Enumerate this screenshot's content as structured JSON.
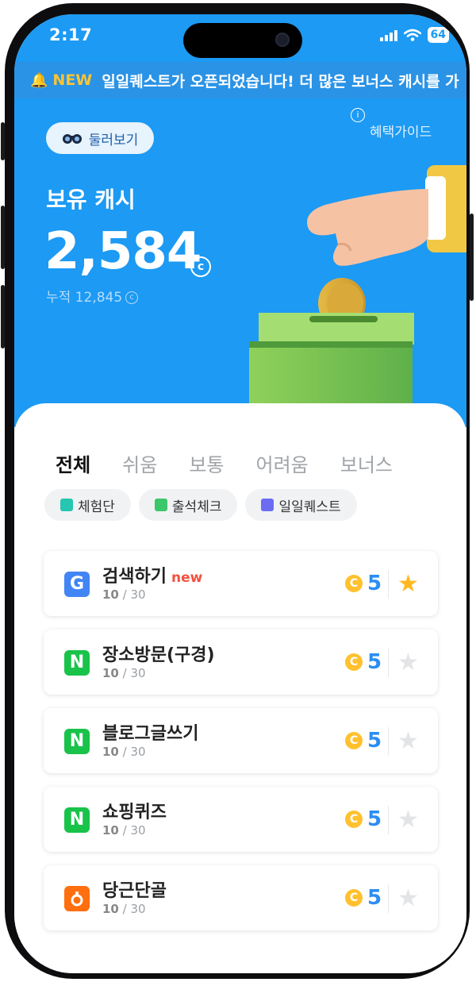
{
  "status": {
    "time": "2:17",
    "battery": "64"
  },
  "ticker": {
    "tag": "NEW",
    "message": "일일퀘스트가 오픈되었습니다! 더 많은 보너스 캐시를 가"
  },
  "header": {
    "explore_label": "둘러보기",
    "guide_label": "혜택가이드"
  },
  "cash": {
    "label": "보유 캐시",
    "value": "2,584",
    "unit_symbol": "©",
    "accumulated": "누적 12,845"
  },
  "tabs": [
    "전체",
    "쉬움",
    "보통",
    "어려움",
    "보너스"
  ],
  "chips": [
    {
      "label": "체험단",
      "color": "#26c6b0"
    },
    {
      "label": "출석체크",
      "color": "#3cc76a"
    },
    {
      "label": "일일퀘스트",
      "color": "#6b6cf2"
    }
  ],
  "missions": [
    {
      "title": "검색하기",
      "badge": "new",
      "progress_done": "10",
      "progress_total": " / 30",
      "reward": "5",
      "logo": "G",
      "logo_color": "#4285f4",
      "starred": true
    },
    {
      "title": "장소방문(구경)",
      "badge": "",
      "progress_done": "10",
      "progress_total": " / 30",
      "reward": "5",
      "logo": "N",
      "logo_color": "#19c34a",
      "starred": false
    },
    {
      "title": "블로그글쓰기",
      "badge": "",
      "progress_done": "10",
      "progress_total": " / 30",
      "reward": "5",
      "logo": "N",
      "logo_color": "#19c34a",
      "starred": false
    },
    {
      "title": "쇼핑퀴즈",
      "badge": "",
      "progress_done": "10",
      "progress_total": " / 30",
      "reward": "5",
      "logo": "N",
      "logo_color": "#19c34a",
      "starred": false
    },
    {
      "title": "당근단골",
      "badge": "",
      "progress_done": "10",
      "progress_total": " / 30",
      "reward": "5",
      "logo": "",
      "logo_color": "#ff6f0f",
      "starred": false
    }
  ],
  "icons": {
    "bell": "bell-icon",
    "explore": "binoculars-icon",
    "info": "info-icon",
    "coin": "coin-icon",
    "star": "star-icon",
    "cash_unit": "cash-c-icon"
  },
  "colors": {
    "primary": "#1c9af4",
    "reward": "#2b8ef2",
    "coin": "#ffc12e",
    "star_active": "#ffb91f",
    "new_badge": "#f2523e"
  }
}
